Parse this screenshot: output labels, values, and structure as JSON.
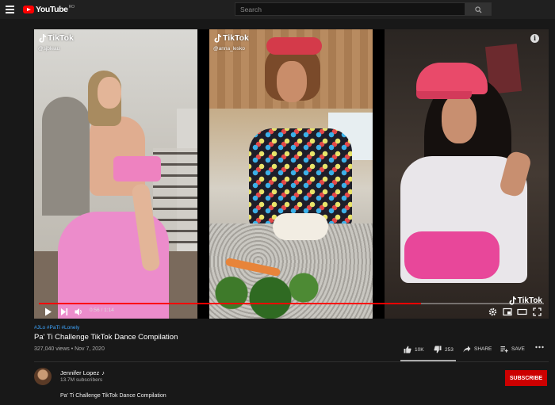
{
  "header": {
    "logo_text": "YouTube",
    "logo_region": "RO",
    "search_placeholder": "Search"
  },
  "player": {
    "panels": [
      {
        "brand": "TikTok",
        "handle": "@sjbleau"
      },
      {
        "brand": "TikTok",
        "handle": "@anna_lesko"
      },
      {
        "brand": "TikTok",
        "handle": ""
      }
    ],
    "corner_brand": "TikTok",
    "info_glyph": "i",
    "current_time": "0:56",
    "duration": "1:14",
    "time_display": "0:56 / 1:14",
    "progress_fraction": 0.757
  },
  "video": {
    "hashtags": "#JLo #PaTi #Lonely",
    "title": "Pa' Ti Challenge TikTok Dance Compilation",
    "meta": "327,040 views • Nov 7, 2020",
    "likes": "10K",
    "dislikes": "253",
    "share_label": "SHARE",
    "save_label": "SAVE"
  },
  "channel": {
    "name": "Jennifer Lopez",
    "verified_glyph": "♪",
    "subscribers": "13.7M subscribers",
    "subscribe_label": "SUBSCRIBE"
  },
  "description": "Pa' Ti Challenge TikTok Dance Compilation",
  "colors": {
    "brand_red": "#ff0000",
    "subscribe_red": "#cc0000",
    "link_blue": "#3ea6ff",
    "background": "#181818"
  },
  "icons": [
    "menu-icon",
    "youtube-logo-icon",
    "search-icon",
    "tiktok-logo-icon",
    "info-icon",
    "play-icon",
    "next-icon",
    "volume-icon",
    "settings-icon",
    "miniplayer-icon",
    "theater-icon",
    "fullscreen-icon",
    "like-icon",
    "dislike-icon",
    "share-icon",
    "save-icon",
    "more-icon",
    "music-note-icon"
  ]
}
